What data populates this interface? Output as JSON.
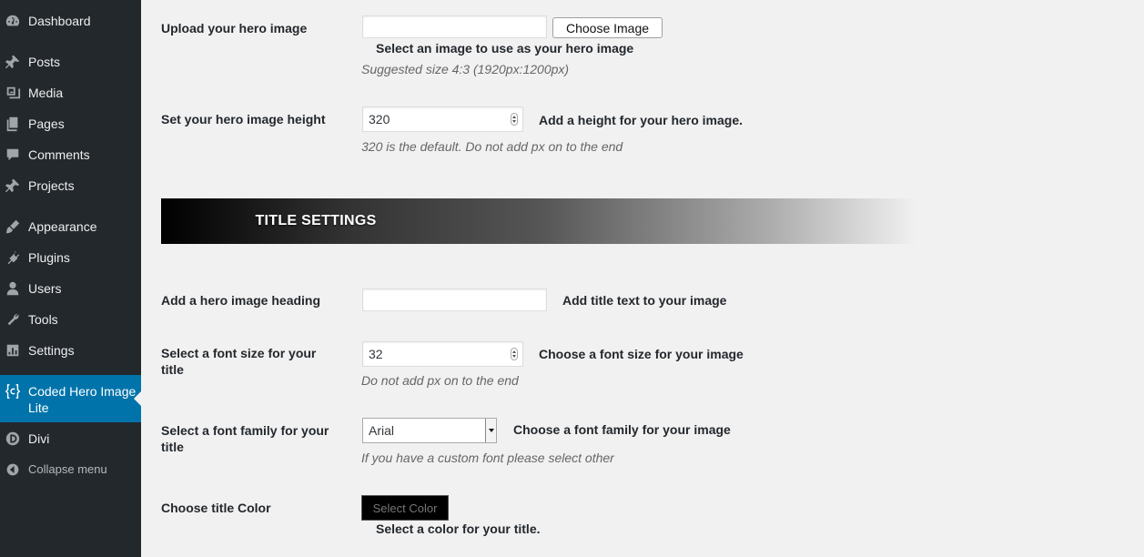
{
  "sidebar": {
    "items": [
      {
        "label": "Dashboard",
        "icon": "dashboard-icon"
      },
      {
        "label": "Posts",
        "icon": "pin-icon"
      },
      {
        "label": "Media",
        "icon": "media-icon"
      },
      {
        "label": "Pages",
        "icon": "pages-icon"
      },
      {
        "label": "Comments",
        "icon": "comment-icon"
      },
      {
        "label": "Projects",
        "icon": "pin-icon"
      },
      {
        "label": "Appearance",
        "icon": "brush-icon"
      },
      {
        "label": "Plugins",
        "icon": "plug-icon"
      },
      {
        "label": "Users",
        "icon": "user-icon"
      },
      {
        "label": "Tools",
        "icon": "wrench-icon"
      },
      {
        "label": "Settings",
        "icon": "settings-icon"
      },
      {
        "label": "Coded Hero Image Lite",
        "icon": "coded-plugin-icon",
        "current": true
      },
      {
        "label": "Divi",
        "icon": "divi-icon"
      },
      {
        "label": "Collapse menu",
        "icon": "collapse-icon"
      }
    ],
    "current_color": "#0073aa",
    "bg_color": "#23282d"
  },
  "hero_image": {
    "label": "Upload your hero image",
    "value": "",
    "button": "Choose Image",
    "hint": "Select an image to use as your hero image",
    "desc": "Suggested size 4:3 (1920px:1200px)"
  },
  "hero_height": {
    "label": "Set your hero image height",
    "value": "320",
    "hint": "Add a height for your hero image.",
    "desc": "320 is the default. Do not add px on to the end"
  },
  "title_settings": {
    "banner": "TITLE SETTINGS"
  },
  "heading": {
    "label": "Add a hero image heading",
    "value": "",
    "hint": "Add title text to your image"
  },
  "font_size": {
    "label": "Select a font size for your title",
    "value": "32",
    "hint": "Choose a font size for your image",
    "desc": "Do not add px on to the end"
  },
  "font_family": {
    "label": "Select a font family for your title",
    "selected": "Arial",
    "hint": "Choose a font family for your image",
    "desc": "If you have a custom font please select other"
  },
  "title_color": {
    "label": "Choose title Color",
    "button": "Select Color",
    "swatch": "#000000",
    "hint": "Select a color for your title."
  }
}
